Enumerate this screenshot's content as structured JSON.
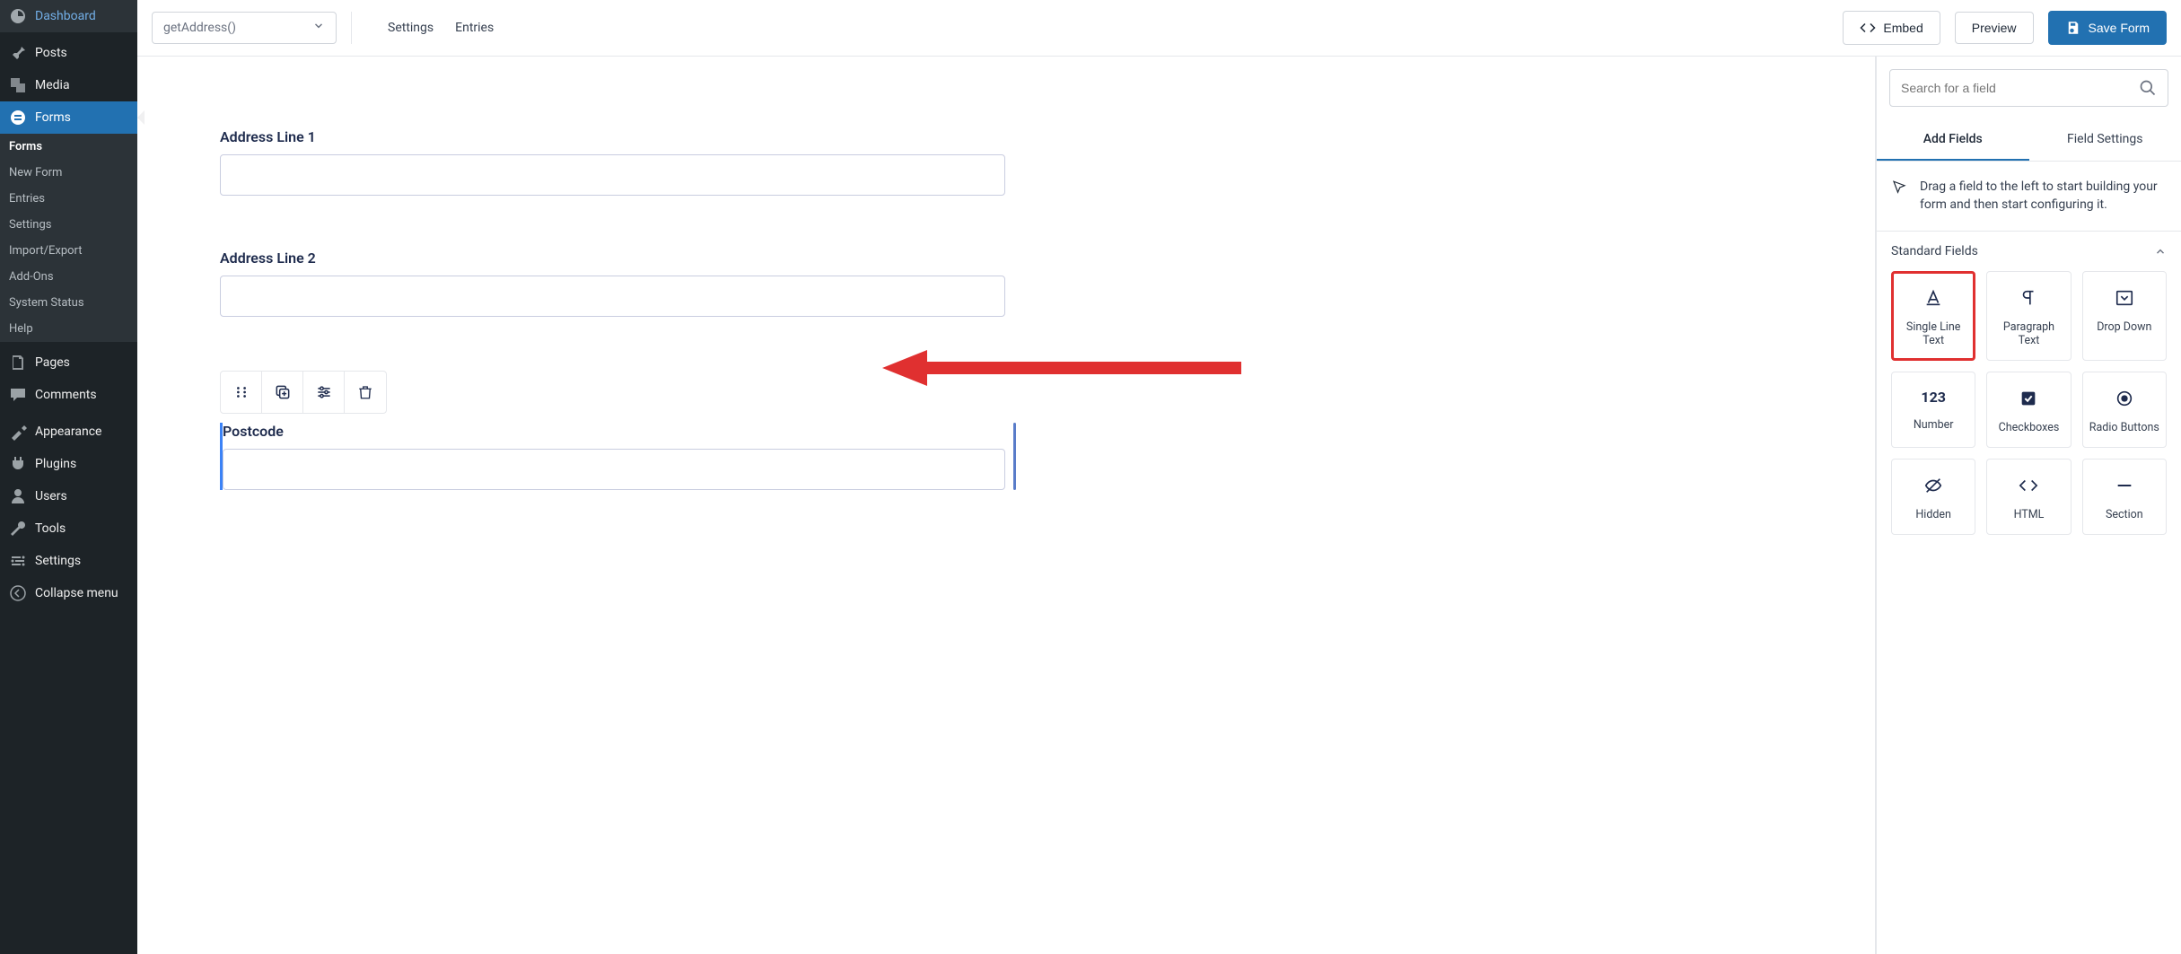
{
  "sidebar": {
    "items": [
      {
        "label": "Dashboard"
      },
      {
        "label": "Posts"
      },
      {
        "label": "Media"
      },
      {
        "label": "Forms"
      },
      {
        "label": "Pages"
      },
      {
        "label": "Comments"
      },
      {
        "label": "Appearance"
      },
      {
        "label": "Plugins"
      },
      {
        "label": "Users"
      },
      {
        "label": "Tools"
      },
      {
        "label": "Settings"
      },
      {
        "label": "Collapse menu"
      }
    ],
    "forms_submenu": [
      {
        "label": "Forms"
      },
      {
        "label": "New Form"
      },
      {
        "label": "Entries"
      },
      {
        "label": "Settings"
      },
      {
        "label": "Import/Export"
      },
      {
        "label": "Add-Ons"
      },
      {
        "label": "System Status"
      },
      {
        "label": "Help"
      }
    ]
  },
  "topbar": {
    "form_name": "getAddress()",
    "links": {
      "settings": "Settings",
      "entries": "Entries"
    },
    "embed": "Embed",
    "preview": "Preview",
    "save": "Save Form"
  },
  "canvas": {
    "fields": [
      {
        "label": "Address Line 1"
      },
      {
        "label": "Address Line 2"
      },
      {
        "label": "Postcode"
      }
    ]
  },
  "panel": {
    "search_placeholder": "Search for a field",
    "tabs": {
      "add": "Add Fields",
      "settings": "Field Settings"
    },
    "hint": "Drag a field to the left to start building your form and then start configuring it.",
    "section_title": "Standard Fields",
    "fields": [
      {
        "label": "Single Line Text"
      },
      {
        "label": "Paragraph Text"
      },
      {
        "label": "Drop Down"
      },
      {
        "label": "Number"
      },
      {
        "label": "Checkboxes"
      },
      {
        "label": "Radio Buttons"
      },
      {
        "label": "Hidden"
      },
      {
        "label": "HTML"
      },
      {
        "label": "Section"
      }
    ]
  }
}
